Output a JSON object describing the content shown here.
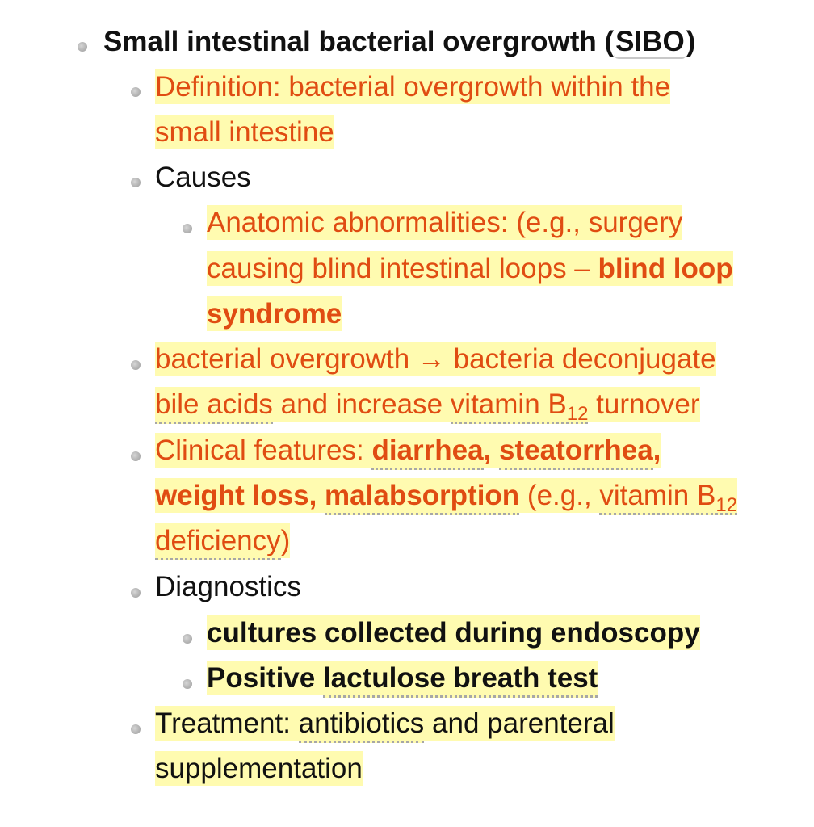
{
  "heading": {
    "text": "Small intestinal bacterial overgrowth (",
    "abbr": "SIBO",
    "close": ")"
  },
  "definition": {
    "line1": "Definition: bacterial overgrowth within the",
    "line2": "small intestine"
  },
  "causes": {
    "label": "Causes",
    "anatomic": {
      "line1": "Anatomic abnormalities: (e.g., surgery",
      "line2_plain": "causing blind intestinal loops – ",
      "line2_bold": "blind loop",
      "line3_bold": "syndrome"
    }
  },
  "mechanism": {
    "line1": "bacterial overgrowth → bacteria deconjugate",
    "line2_term1": "bile acids",
    "line2_mid": " and increase ",
    "line2_term2": "vitamin B",
    "line2_sub": "12",
    "line2_end": " turnover"
  },
  "clinical": {
    "prefix": "Clinical features: ",
    "diarrhea": "diarrhea",
    "comma1": ", ",
    "steatorrhea": "steatorrhea",
    "comma2": ",",
    "weight_loss": "weight loss",
    "comma3": ", ",
    "malabsorption": "malabsorption",
    "paren_open": " (e.g., ",
    "vitamin": "vitamin B",
    "vitamin_sub": "12",
    "deficiency": "deficiency",
    "paren_close": ")"
  },
  "diagnostics": {
    "label": "Diagnostics",
    "items": [
      "cultures collected during endoscopy",
      "Positive lactulose breath test"
    ],
    "lactulose_prefix": "Positive ",
    "lactulose_term": "lactulose breath test"
  },
  "treatment": {
    "prefix": "Treatment: ",
    "term": "antibiotics",
    "rest": " and parenteral",
    "line2": "supplementation"
  },
  "colors": {
    "accent": "#e04c12",
    "highlight": "#fffbb0",
    "text": "#111111"
  }
}
